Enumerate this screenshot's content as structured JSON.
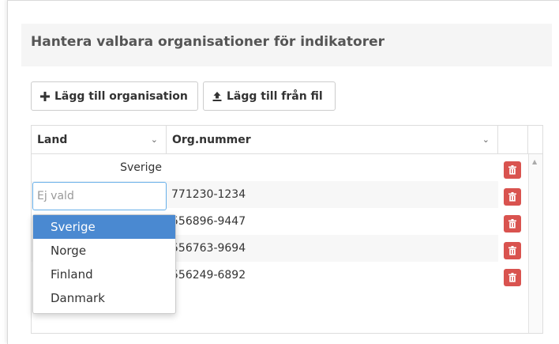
{
  "header": {
    "title": "Hantera valbara organisationer för indikatorer"
  },
  "toolbar": {
    "add_label": "Lägg till organisation",
    "add_icon": "plus-icon",
    "file_label": "Lägg till från fil",
    "file_icon": "upload-icon"
  },
  "grid": {
    "columns": [
      {
        "label": "Land"
      },
      {
        "label": "Org.nummer"
      }
    ],
    "rows": [
      {
        "land": "Sverige",
        "org": ""
      },
      {
        "land": "",
        "org": "771230-1234"
      },
      {
        "land": "",
        "org": "556896-9447"
      },
      {
        "land": "",
        "org": "556763-9694"
      },
      {
        "land": "",
        "org": "556249-6892"
      }
    ],
    "delete_icon": "trash-icon"
  },
  "editor": {
    "placeholder": "Ej vald",
    "options": [
      "Sverige",
      "Norge",
      "Finland",
      "Danmark"
    ],
    "highlighted": "Sverige"
  },
  "colors": {
    "danger": "#d9534f",
    "highlight": "#4a89d1",
    "focus": "#66afe9"
  }
}
